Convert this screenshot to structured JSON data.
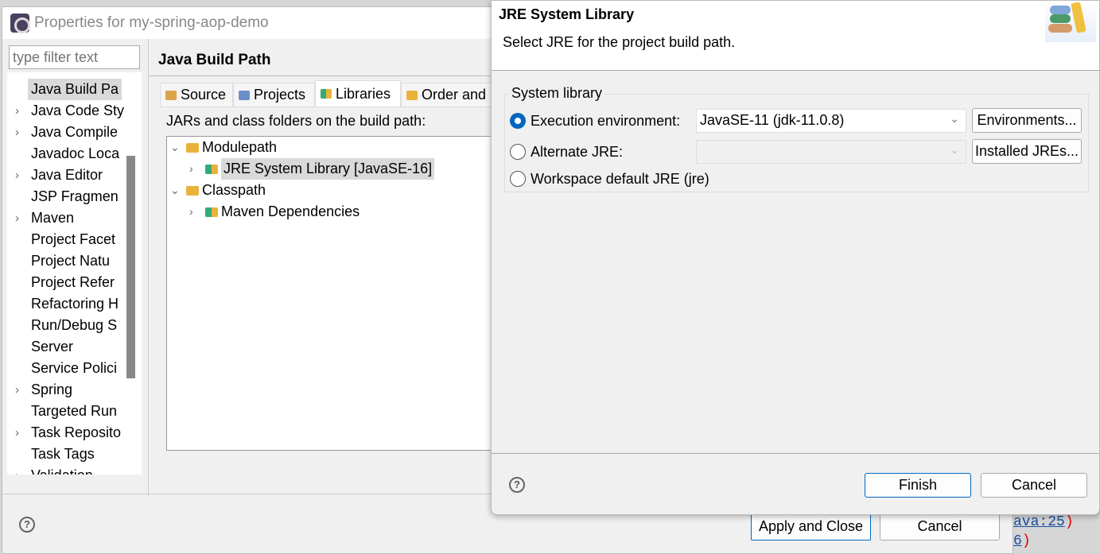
{
  "background_dialog": {
    "title": "Properties for my-spring-aop-demo",
    "filter_placeholder": "type filter text",
    "tree_items": [
      {
        "label": "Java Build Pa",
        "expandable": false,
        "selected": true
      },
      {
        "label": "Java Code Sty",
        "expandable": true
      },
      {
        "label": "Java Compile",
        "expandable": true
      },
      {
        "label": "Javadoc Loca",
        "expandable": false
      },
      {
        "label": "Java Editor",
        "expandable": true
      },
      {
        "label": "JSP Fragmen",
        "expandable": false
      },
      {
        "label": "Maven",
        "expandable": true
      },
      {
        "label": "Project Facet",
        "expandable": false
      },
      {
        "label": "Project Natu",
        "expandable": false
      },
      {
        "label": "Project Refer",
        "expandable": false
      },
      {
        "label": "Refactoring H",
        "expandable": false
      },
      {
        "label": "Run/Debug S",
        "expandable": false
      },
      {
        "label": "Server",
        "expandable": false
      },
      {
        "label": "Service Polici",
        "expandable": false
      },
      {
        "label": "Spring",
        "expandable": true
      },
      {
        "label": "Targeted Run",
        "expandable": false
      },
      {
        "label": "Task Reposito",
        "expandable": true
      },
      {
        "label": "Task Tags",
        "expandable": false
      },
      {
        "label": "Validation",
        "expandable": true
      }
    ],
    "page_title": "Java Build Path",
    "tabs": [
      {
        "label": "Source"
      },
      {
        "label": "Projects"
      },
      {
        "label": "Libraries",
        "active": true
      },
      {
        "label": "Order and"
      }
    ],
    "jars_label": "JARs and class folders on the build path:",
    "build_path": {
      "modulepath": "Modulepath",
      "jre": "JRE System Library [JavaSE-16]",
      "classpath": "Classpath",
      "maven": "Maven Dependencies"
    },
    "apply_close": "Apply and Close",
    "cancel": "Cancel"
  },
  "code_behind": {
    "line1_link": "ava:25",
    "line1_paren": ")",
    "line2_link": "6",
    "line2_paren": ")"
  },
  "modal": {
    "title": "JRE System Library",
    "subtitle": "Select JRE for the project build path.",
    "group_label": "System library",
    "exec_env_label": "Execution environment:",
    "exec_env_value": "JavaSE-11 (jdk-11.0.8)",
    "environments_button": "Environments...",
    "alternate_label": "Alternate JRE:",
    "alternate_value": "",
    "installed_button": "Installed JREs...",
    "workspace_label": "Workspace default JRE (jre)",
    "selected_option": "execution_environment",
    "finish": "Finish",
    "cancel": "Cancel"
  },
  "colors": {
    "accent": "#0067c0",
    "selection": "#d9d9d9"
  }
}
